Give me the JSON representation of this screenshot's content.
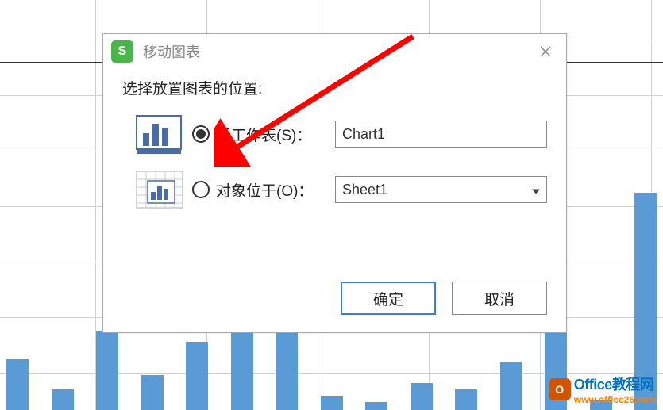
{
  "dialog": {
    "title": "移动图表",
    "prompt": "选择放置图表的位置:",
    "option_new_sheet": {
      "label": "新工作表(S)：",
      "value": "Chart1",
      "selected": true
    },
    "option_object_in": {
      "label": "对象位于(O)：",
      "value": "Sheet1",
      "selected": false
    },
    "ok_label": "确定",
    "cancel_label": "取消"
  },
  "watermark": {
    "line1_en": "Office",
    "line1_cn": "教程网",
    "line2": "www.office26.com"
  },
  "chart_data": {
    "type": "bar",
    "note": "background bar chart partially visible behind dialog; heights estimated in pixels from bottom",
    "values": [
      64,
      26,
      100,
      44,
      86,
      128,
      110,
      18,
      10,
      34,
      26,
      60,
      186,
      12,
      274
    ],
    "color": "#5b9bd5"
  }
}
